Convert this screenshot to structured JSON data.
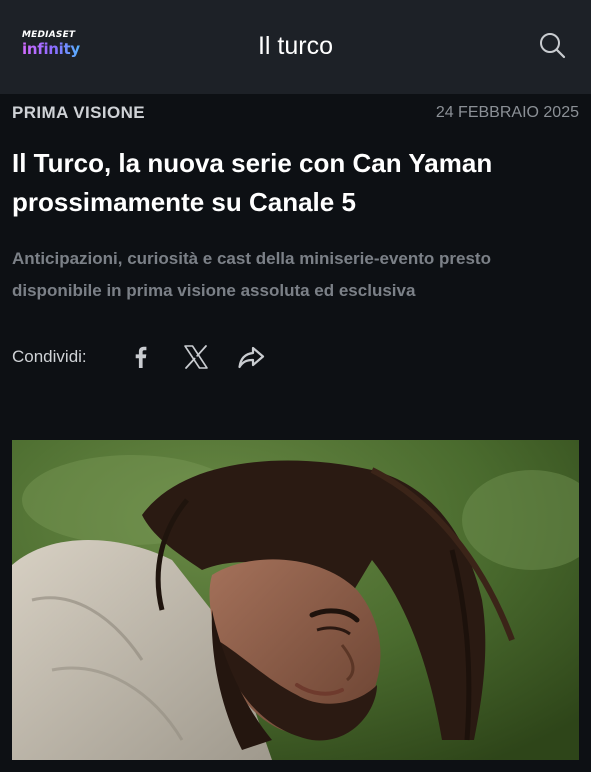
{
  "header": {
    "logo": {
      "top_text": "MEDIASET",
      "bottom_text": "infinity"
    },
    "title": "Il turco",
    "search_icon": "search-icon"
  },
  "article": {
    "kicker": "PRIMA VISIONE",
    "date": "24 FEBBRAIO 2025",
    "headline": "Il Turco, la nuova serie con Can Yaman prossimamente su Canale 5",
    "subtitle": "Anticipazioni, curiosità e cast della miniserie-evento presto disponibile in prima visione assoluta ed esclusiva"
  },
  "share": {
    "label": "Condividi:",
    "icons": [
      "facebook-icon",
      "x-icon",
      "share-arrow-icon"
    ]
  },
  "colors": {
    "header_bg": "#1d2127",
    "page_bg": "#0d1014",
    "subtitle_text": "#7b8087"
  }
}
